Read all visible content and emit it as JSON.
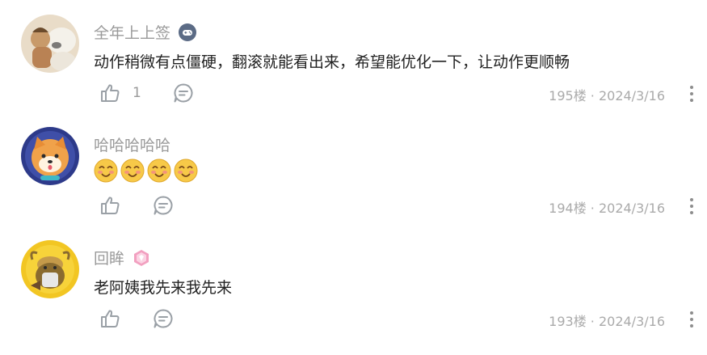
{
  "comments": [
    {
      "username": "全年上上签",
      "badge_icon": "gamepad-badge-icon",
      "text": "动作稍微有点僵硬，翻滚就能看出来，希望能优化一下，让动作更顺畅",
      "like_count": "1",
      "meta": "195楼 · 2024/3/16"
    },
    {
      "username": "哈哈哈哈哈",
      "emoji": [
        "shy-smile-emoji",
        "shy-smile-emoji",
        "shy-smile-emoji",
        "shy-smile-emoji"
      ],
      "meta": "194楼 · 2024/3/16"
    },
    {
      "username": "回眸",
      "badge_icon": "pink-level-badge-icon",
      "text": "老阿姨我先来我先来",
      "meta": "193楼 · 2024/3/16"
    }
  ],
  "colors": {
    "username": "#9a9a9a",
    "text": "#222222",
    "meta": "#aaaaaa",
    "icon": "#9aa0a6",
    "badge_blue": "#5b6b85",
    "badge_pink": "#f2a0c0"
  }
}
